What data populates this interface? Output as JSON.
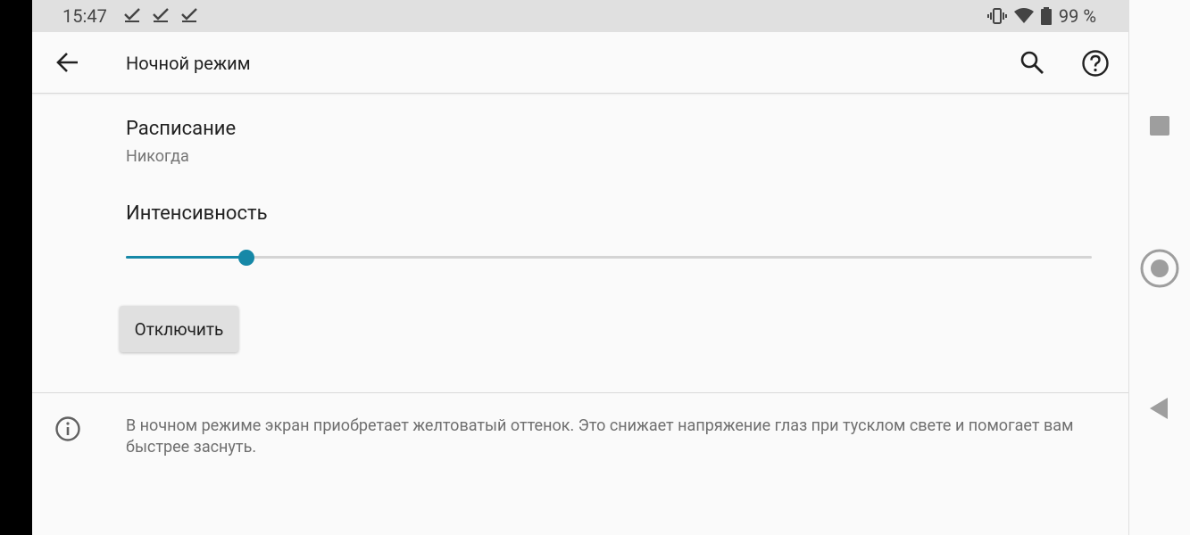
{
  "status_bar": {
    "time": "15:47",
    "notification_icons": [
      "check-icon",
      "check-icon",
      "check-icon"
    ],
    "battery": "99 %",
    "icons": [
      "vibrate-icon",
      "wifi-icon",
      "battery-icon"
    ]
  },
  "app_bar": {
    "title": "Ночной режим",
    "icons": [
      "back-arrow-icon",
      "search-icon",
      "help-icon"
    ]
  },
  "schedule": {
    "title": "Расписание",
    "value": "Никогда"
  },
  "intensity": {
    "label": "Интенсивность",
    "slider_value": 0.125
  },
  "turn_off_button": {
    "label": "Отключить"
  },
  "info": {
    "icon": "info-icon",
    "text": "В ночном режиме экран приобретает желтоватый оттенок. Это снижает напряжение глаз при тусклом свете и помогает вам быстрее заснуть."
  },
  "colors": {
    "accent": "#1688a7",
    "background": "#fafafa",
    "status_bar": "#e0e0e0",
    "button": "#e0e0e0"
  },
  "nav_bar": {
    "icons": [
      "recents-icon",
      "home-icon",
      "back-icon"
    ]
  }
}
